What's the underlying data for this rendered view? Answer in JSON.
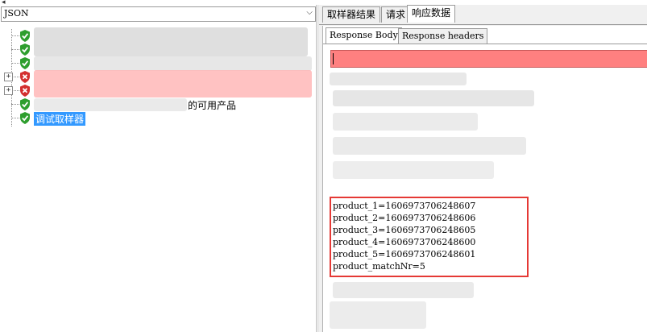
{
  "left": {
    "combo_value": "JSON",
    "tree_nodes": [
      {
        "status": "pass",
        "label": "",
        "expandable": false
      },
      {
        "status": "pass",
        "label": "",
        "expandable": false
      },
      {
        "status": "pass",
        "label": "",
        "expandable": false
      },
      {
        "status": "fail",
        "label": "",
        "expandable": true
      },
      {
        "status": "fail",
        "label": "",
        "expandable": true
      },
      {
        "status": "pass",
        "label": "的可用产品",
        "expandable": false
      },
      {
        "status": "pass",
        "label": "调试取样器",
        "expandable": false,
        "selected": true
      }
    ]
  },
  "right": {
    "tabs": [
      "取样器结果",
      "请求",
      "响应数据"
    ],
    "active_tab": "响应数据",
    "subtabs": [
      "Response Body",
      "Response headers"
    ],
    "active_subtab": "Response Body",
    "response_lines": [
      "product_1=1606973706248607",
      "product_2=1606973706248606",
      "product_3=1606973706248605",
      "product_4=1606973706248600",
      "product_5=1606973706248601",
      "product_matchNr=5"
    ]
  },
  "colors": {
    "search_bg": "#ff8080",
    "highlight_border": "#e53935",
    "selection": "#3399ff",
    "pass": "#2e9e2e",
    "fail": "#d32f2f"
  }
}
